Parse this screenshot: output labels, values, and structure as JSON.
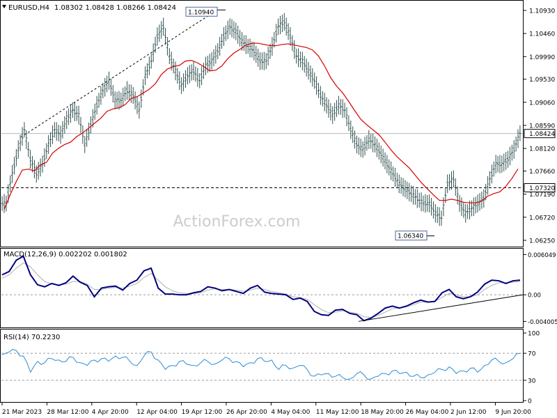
{
  "header": {
    "symbol_text": "EURUSD,H4",
    "ohlc_text": "1.08302 1.08428 1.08266 1.08424",
    "macd_label": "MACD(12,26,9) 0.002202 0.001802",
    "rsi_label": "RSI(14) 70.2230",
    "watermark": "ActionForex.com"
  },
  "colors": {
    "background": "#ffffff",
    "grid": "#d9d9d9",
    "price_bars": "#2f4f4f",
    "moving_average": "#d40000",
    "macd_line": "#000080",
    "signal_line": "#b0b0b0",
    "rsi_line": "#2b8bd3",
    "trendline": "#000000"
  },
  "chart_data": [
    {
      "type": "ohlc",
      "panel": "price",
      "y_axis": {
        "ticks": [
          "1.10930",
          "1.10460",
          "1.09990",
          "1.09530",
          "1.09060",
          "1.08590",
          "1.08120",
          "1.07660",
          "1.07190",
          "1.06720",
          "1.06250"
        ],
        "ylim": [
          1.0615,
          1.111
        ]
      },
      "markers": {
        "last_price": "1.08424",
        "horizontal_level": "1.07320",
        "high_label": "1.10940",
        "low_label": "1.06340"
      },
      "x_axis": {
        "labels": [
          "21 Mar 2023",
          "28 Mar 12:00",
          "4 Apr 20:00",
          "12 Apr 04:00",
          "19 Apr 12:00",
          "26 Apr 20:00",
          "4 May 04:00",
          "11 May 12:00",
          "18 May 20:00",
          "26 May 04:00",
          "2 Jun 12:00",
          "9 Jun 20:00"
        ]
      },
      "close_series": [
        1.07,
        1.076,
        1.081,
        1.085,
        1.079,
        1.076,
        1.078,
        1.082,
        1.085,
        1.084,
        1.087,
        1.089,
        1.088,
        1.082,
        1.086,
        1.09,
        1.093,
        1.095,
        1.091,
        1.091,
        1.093,
        1.092,
        1.089,
        1.096,
        1.099,
        1.104,
        1.106,
        1.1,
        1.097,
        1.094,
        1.096,
        1.097,
        1.095,
        1.098,
        1.099,
        1.101,
        1.104,
        1.106,
        1.105,
        1.103,
        1.102,
        1.101,
        1.099,
        1.099,
        1.102,
        1.106,
        1.107,
        1.104,
        1.1,
        1.099,
        1.097,
        1.095,
        1.092,
        1.09,
        1.088,
        1.09,
        1.089,
        1.085,
        1.082,
        1.081,
        1.083,
        1.082,
        1.08,
        1.078,
        1.076,
        1.074,
        1.073,
        1.072,
        1.071,
        1.07,
        1.07,
        1.068,
        1.067,
        1.074,
        1.075,
        1.07,
        1.068,
        1.069,
        1.07,
        1.071,
        1.075,
        1.078,
        1.078,
        1.079,
        1.081,
        1.0843
      ],
      "bar_range": 0.003
    },
    {
      "type": "line",
      "panel": "macd",
      "y_axis": {
        "ticks": [
          "0.006049",
          "0.00",
          "-0.004005"
        ],
        "ylim": [
          -0.0047,
          0.0064
        ]
      },
      "series": [
        {
          "values": [
            0.003,
            0.0035,
            0.0052,
            0.0058,
            0.003,
            0.0015,
            0.0012,
            0.0017,
            0.0014,
            0.0018,
            0.0028,
            0.0019,
            0.0014,
            -0.0003,
            0.001,
            0.0012,
            0.0013,
            0.0007,
            0.0017,
            0.0022,
            0.0036,
            0.004,
            0.001,
            0.0001,
            0.0001,
            0.0,
            0.0,
            0.0003,
            0.0005,
            0.0012,
            0.001,
            0.0006,
            0.0008,
            0.0005,
            0.0002,
            0.001,
            0.0014,
            0.0004,
            0.0002,
            0.0001,
            0.0,
            -0.0007,
            -0.0005,
            -0.001,
            -0.0025,
            -0.003,
            -0.0031,
            -0.0023,
            -0.0022,
            -0.0028,
            -0.003,
            -0.0039,
            -0.0035,
            -0.0028,
            -0.002,
            -0.0017,
            -0.002,
            -0.0017,
            -0.0012,
            -0.0008,
            -0.0011,
            -0.001,
            0.0003,
            0.0008,
            -0.0003,
            -0.0006,
            -0.0003,
            0.0004,
            0.0016,
            0.0022,
            0.0021,
            0.0017,
            0.0021,
            0.0022
          ]
        },
        {
          "values": [
            0.0025,
            0.003,
            0.004,
            0.0048,
            0.0042,
            0.003,
            0.002,
            0.0016,
            0.0015,
            0.0016,
            0.002,
            0.002,
            0.0016,
            0.0008,
            0.0008,
            0.001,
            0.0011,
            0.001,
            0.0013,
            0.0017,
            0.0026,
            0.0032,
            0.0022,
            0.0012,
            0.0006,
            0.0003,
            0.0002,
            0.0002,
            0.0003,
            0.0007,
            0.0009,
            0.0008,
            0.0008,
            0.0007,
            0.0005,
            0.0007,
            0.001,
            0.0008,
            0.0005,
            0.0003,
            0.0001,
            -0.0003,
            -0.0004,
            -0.0007,
            -0.0015,
            -0.0022,
            -0.0027,
            -0.0026,
            -0.0024,
            -0.0026,
            -0.0028,
            -0.0033,
            -0.0034,
            -0.0031,
            -0.0026,
            -0.0021,
            -0.002,
            -0.0018,
            -0.0015,
            -0.0011,
            -0.0011,
            -0.001,
            -0.0004,
            0.0002,
            0.0,
            -0.0003,
            -0.0003,
            0.0,
            0.0008,
            0.0014,
            0.0018,
            0.0018,
            0.0019,
            0.002
          ]
        }
      ]
    },
    {
      "type": "line",
      "panel": "rsi",
      "y_axis": {
        "ticks": [
          "100",
          "70",
          "30",
          "0"
        ],
        "ylim": [
          0,
          100
        ]
      },
      "levels": [
        70,
        30
      ],
      "series": [
        {
          "values": [
            68,
            72,
            74,
            66,
            42,
            58,
            56,
            62,
            60,
            58,
            64,
            56,
            52,
            60,
            62,
            58,
            66,
            64,
            58,
            52,
            66,
            72,
            60,
            46,
            52,
            58,
            54,
            52,
            56,
            58,
            54,
            60,
            62,
            58,
            50,
            56,
            62,
            58,
            60,
            46,
            52,
            48,
            52,
            46,
            36,
            38,
            40,
            36,
            34,
            32,
            40,
            38,
            32,
            36,
            40,
            44,
            40,
            42,
            36,
            34,
            38,
            42,
            46,
            50,
            40,
            44,
            48,
            42,
            52,
            60,
            58,
            56,
            62,
            70
          ]
        }
      ]
    }
  ]
}
